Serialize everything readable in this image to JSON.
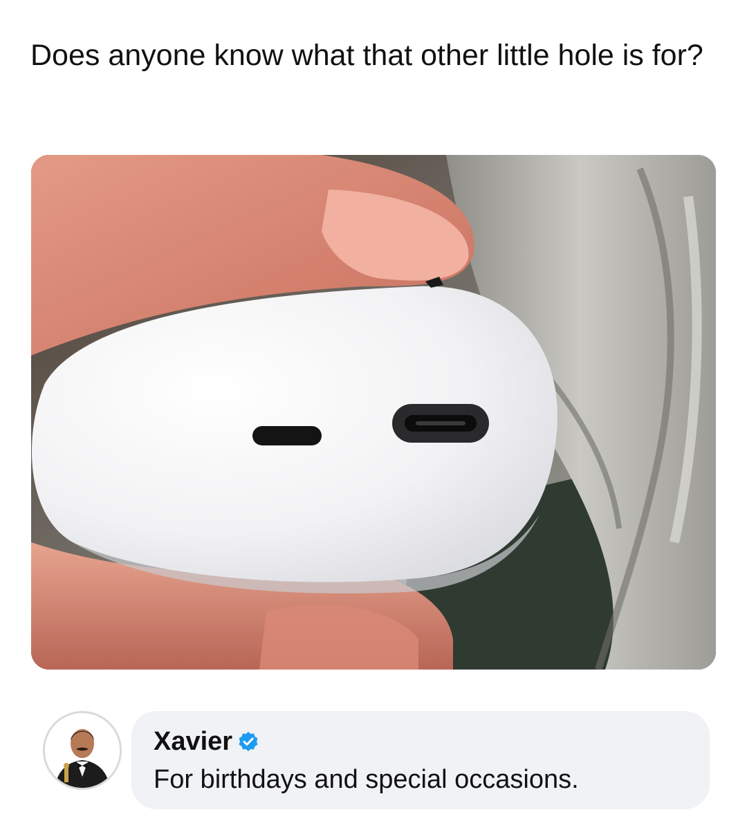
{
  "post": {
    "text": "Does anyone know what that other little hole is for?"
  },
  "photo": {
    "subject": "white earbud case with usb-c port"
  },
  "comment": {
    "author": "Xavier",
    "verified": true,
    "verified_color": "#1d9bf0",
    "text": "For birthdays and special occasions."
  }
}
